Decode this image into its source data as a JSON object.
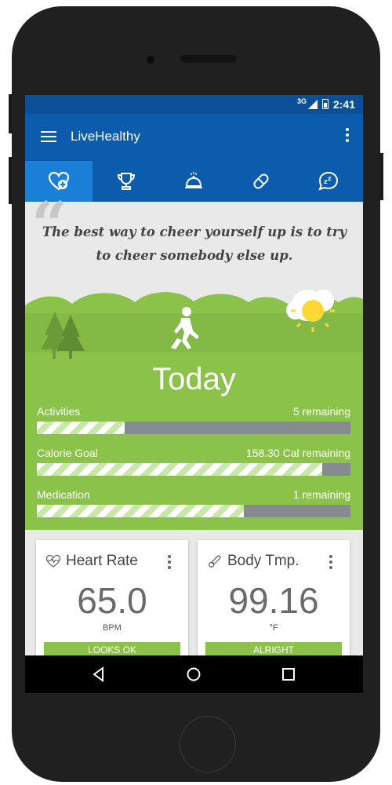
{
  "status_bar": {
    "network": "3G",
    "time": "2:41"
  },
  "app_bar": {
    "title": "LiveHealthy"
  },
  "tabs": [
    {
      "icon": "heart-plus-icon",
      "active": true
    },
    {
      "icon": "trophy-icon",
      "active": false
    },
    {
      "icon": "food-tray-icon",
      "active": false
    },
    {
      "icon": "pill-icon",
      "active": false
    },
    {
      "icon": "sleep-icon",
      "active": false
    }
  ],
  "quote": {
    "text": "The best way to cheer yourself up is to try to cheer somebody else up."
  },
  "today": {
    "title": "Today",
    "progress": [
      {
        "label": "Activities",
        "remaining": "5 remaining",
        "fraction": 0.28
      },
      {
        "label": "Calorie Goal",
        "remaining": "158.30 Cal remaining",
        "fraction": 0.91
      },
      {
        "label": "Medication",
        "remaining": "1 remaining",
        "fraction": 0.66
      }
    ]
  },
  "cards": [
    {
      "title": "Heart Rate",
      "icon": "heart-pulse-icon",
      "value": "65.0",
      "unit": "BPM",
      "status": "LOOKS OK"
    },
    {
      "title": "Body Tmp.",
      "icon": "thermometer-icon",
      "value": "99.16",
      "unit": "°F",
      "status": "ALRIGHT"
    }
  ],
  "colors": {
    "primary": "#0b5cad",
    "active_tab": "#1a7fd6",
    "green": "#8bc34a",
    "bar_bg": "#868b90"
  }
}
